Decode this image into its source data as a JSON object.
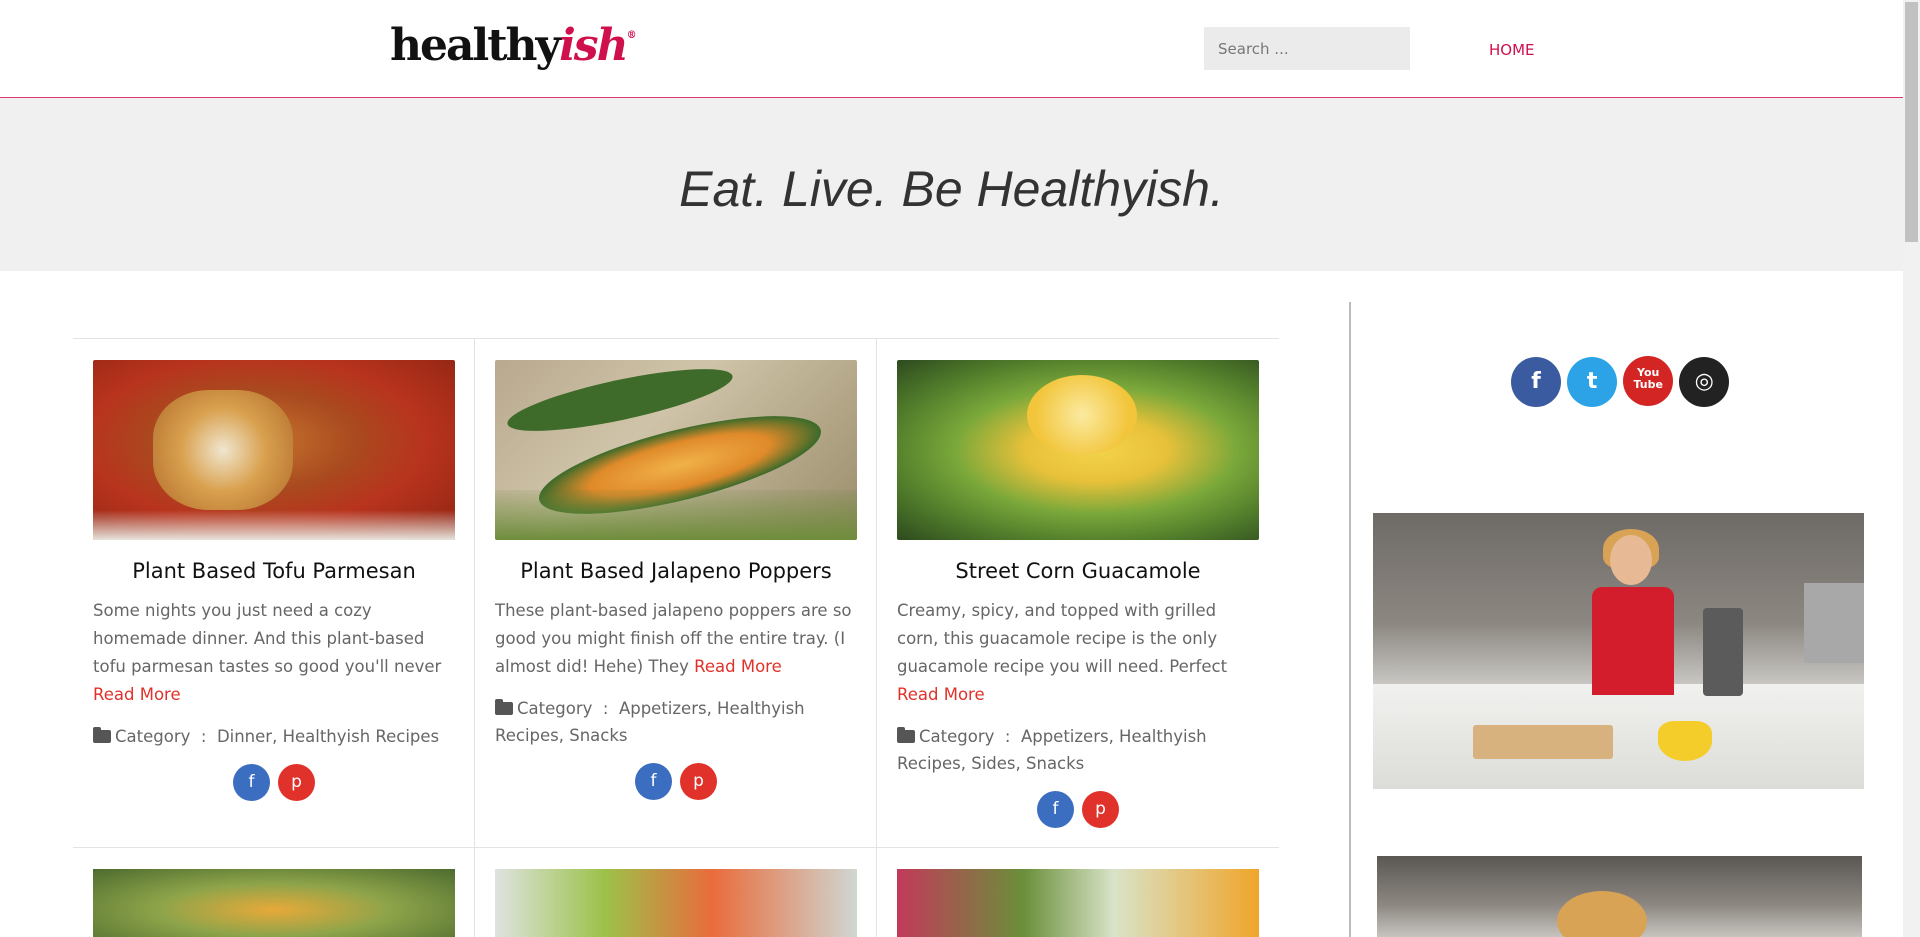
{
  "header": {
    "logo_main": "healthy",
    "logo_accent": "ish",
    "logo_reg": "®",
    "search_placeholder": "Search ...",
    "nav_home": "HOME"
  },
  "hero": {
    "tagline": "Eat. Live. Be Healthyish."
  },
  "posts": [
    {
      "title": "Plant Based Tofu Parmesan",
      "excerpt": "Some nights you just need a cozy homemade dinner. And this plant-based tofu parmesan tastes so good you'll never",
      "read_more": "Read More",
      "category_label": "Category",
      "category_sep": ":",
      "categories": "Dinner, Healthyish Recipes"
    },
    {
      "title": "Plant Based Jalapeno Poppers",
      "excerpt": "These plant-based jalapeno poppers are so good you might finish off the entire tray. (I almost did! Hehe) They",
      "read_more": "Read More",
      "category_label": "Category",
      "category_sep": ":",
      "categories": "Appetizers, Healthyish Recipes, Snacks"
    },
    {
      "title": "Street Corn Guacamole",
      "excerpt": "Creamy, spicy, and topped with grilled corn, this guacamole recipe is the only guacamole recipe you will need. Perfect",
      "read_more": "Read More",
      "category_label": "Category",
      "category_sep": ":",
      "categories": "Appetizers, Healthyish Recipes, Sides, Snacks"
    }
  ],
  "share": {
    "facebook_glyph": "f",
    "pinterest_glyph": "p"
  },
  "sidebar": {
    "social": {
      "facebook_glyph": "f",
      "twitter_glyph": "t",
      "youtube_glyph_1": "You",
      "youtube_glyph_2": "Tube",
      "instagram_glyph": "◎"
    }
  },
  "colors": {
    "brand": "#d0104c",
    "link": "#e0322a",
    "facebook": "#3b6ec0",
    "twitter": "#2ba3e6",
    "youtube": "#d42525",
    "instagram": "#222222"
  }
}
